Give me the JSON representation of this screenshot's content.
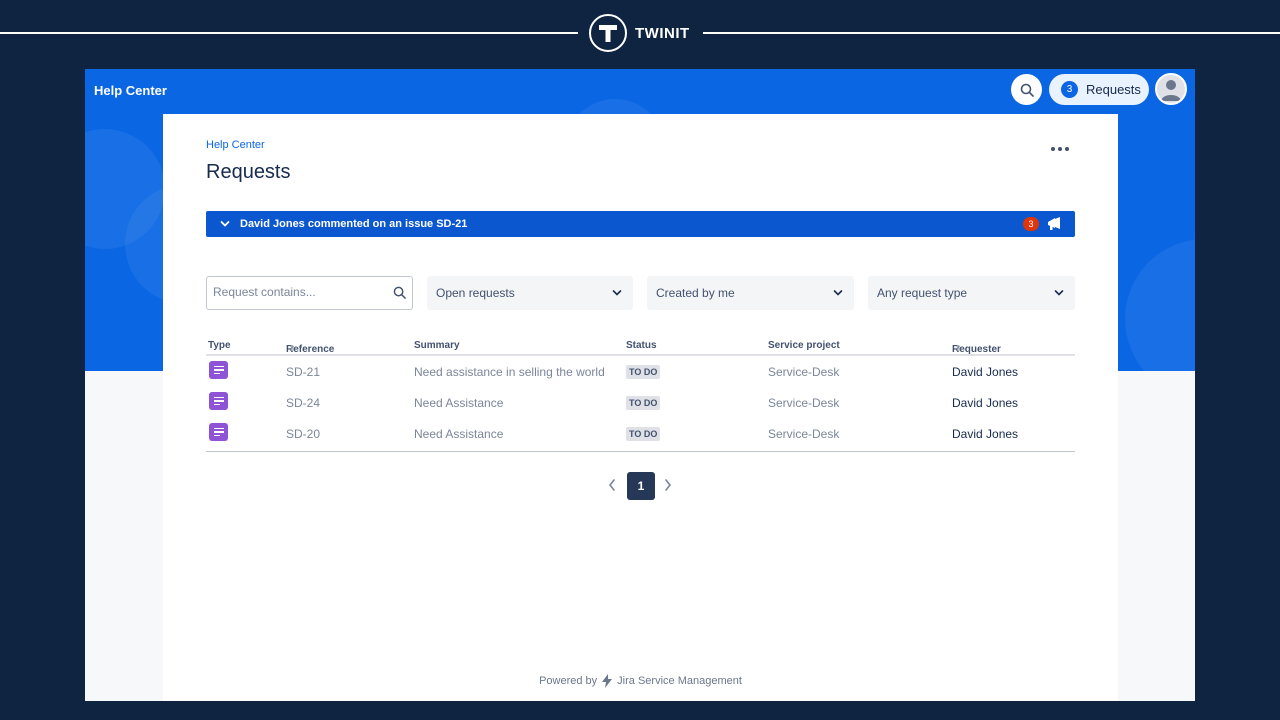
{
  "brand": {
    "name": "TWINIT",
    "logo_letter": "T",
    "logo_icon": "twinit-logo"
  },
  "topbar": {
    "title": "Help Center",
    "search_icon": "search-icon",
    "requests_label": "Requests",
    "requests_count": "3",
    "avatar_icon": "user-avatar-icon"
  },
  "page": {
    "breadcrumb": "Help Center",
    "title": "Requests",
    "more_icon": "more-horizontal-icon"
  },
  "notification": {
    "text": "David Jones commented on an issue SD-21",
    "count": "3",
    "icon": "megaphone-icon",
    "color": "#0b57d0"
  },
  "filters": {
    "search_placeholder": "Request contains...",
    "search_value": "",
    "status": "Open requests",
    "created_by": "Created by me",
    "request_type": "Any request type"
  },
  "table": {
    "columns": [
      "Type",
      "Reference",
      "Summary",
      "Status",
      "Service project",
      "Requester"
    ],
    "sortable_mark": "⇕",
    "rows": [
      {
        "type_icon": "document-icon",
        "reference": "SD-21",
        "summary": "Need assistance in selling the world",
        "status": "TO DO",
        "project": "Service-Desk",
        "requester": "David Jones"
      },
      {
        "type_icon": "document-icon",
        "reference": "SD-24",
        "summary": "Need Assistance",
        "status": "TO DO",
        "project": "Service-Desk",
        "requester": "David Jones"
      },
      {
        "type_icon": "document-icon",
        "reference": "SD-20",
        "summary": "Need Assistance",
        "status": "TO DO",
        "project": "Service-Desk",
        "requester": "David Jones"
      }
    ]
  },
  "pagination": {
    "current": "1"
  },
  "footer": {
    "powered_by": "Powered by",
    "product": "Jira Service Management"
  },
  "colors": {
    "background": "#0f2440",
    "hero": "#0b66e4",
    "accent": "#0c66e4",
    "type_icon": "#8f53d6"
  }
}
